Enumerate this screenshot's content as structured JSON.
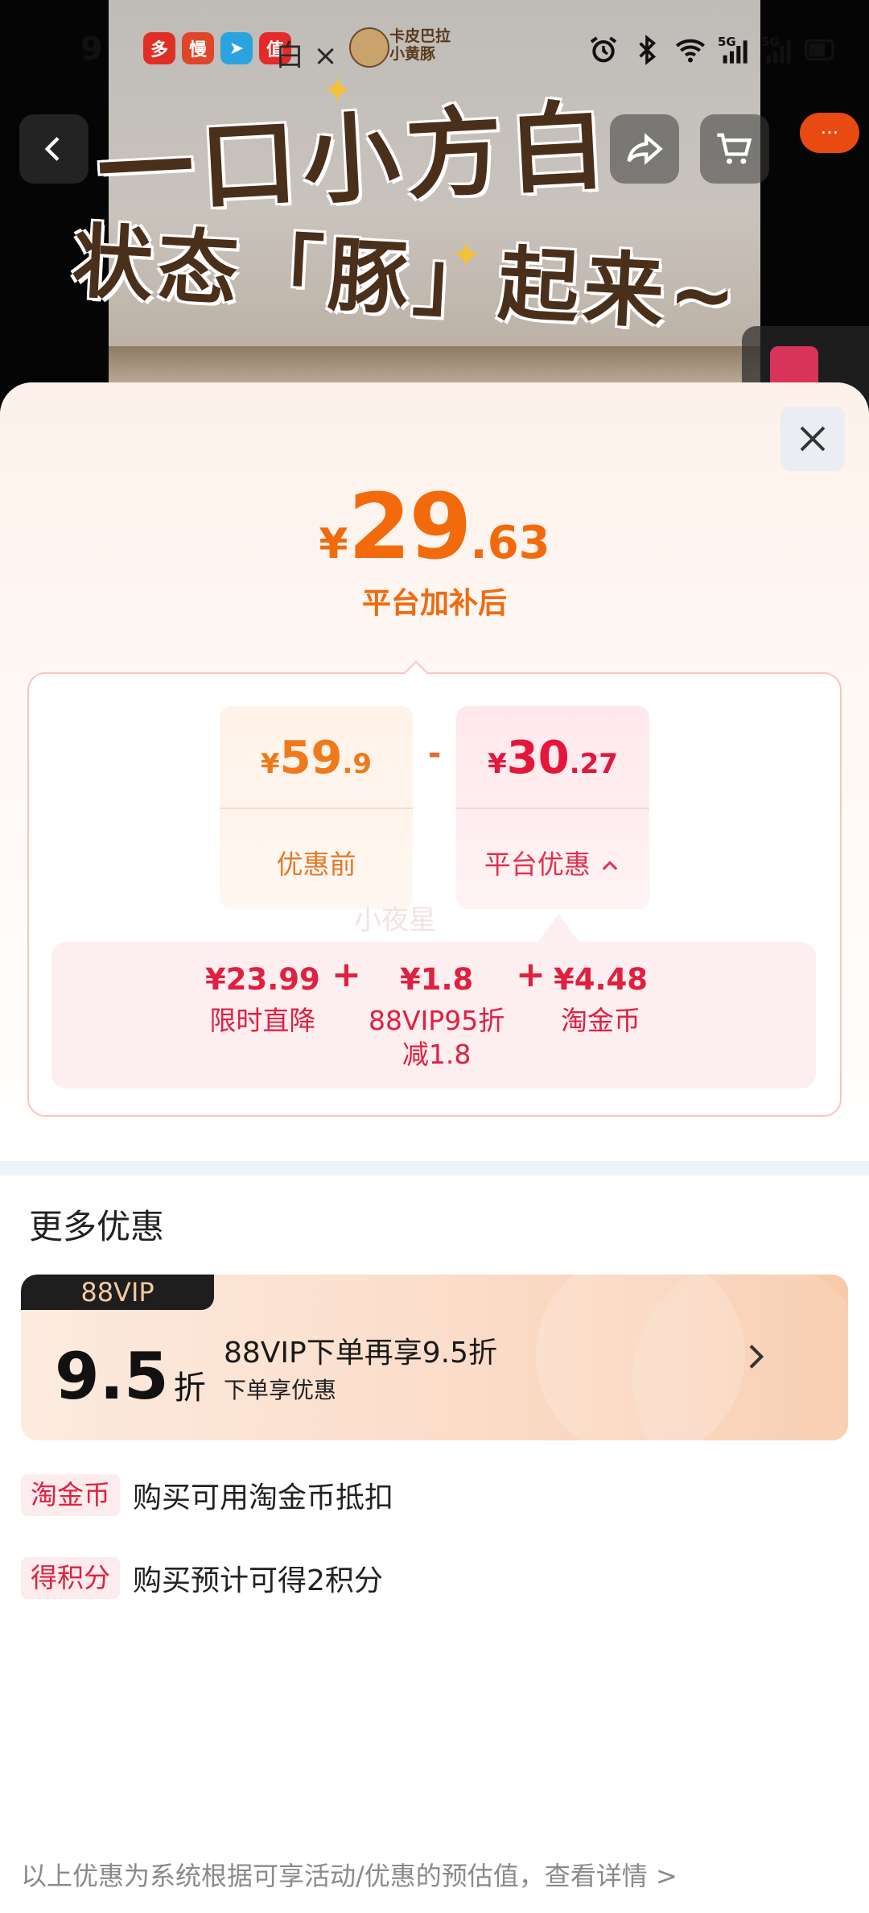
{
  "status_bar": {
    "time": "9",
    "notif_icons": [
      {
        "name": "pinduoduo-icon",
        "glyph": "多",
        "color": "#e02e24"
      },
      {
        "name": "app-icon",
        "glyph": "慢",
        "color": "#e0452a"
      },
      {
        "name": "telegram-icon",
        "glyph": "➤",
        "color": "#2aa3de"
      },
      {
        "name": "zhidemai-icon",
        "glyph": "值",
        "color": "#e32b2b"
      }
    ],
    "text": "白 ×"
  },
  "banner": {
    "line1": "一口小方白",
    "line2": "状态「豚」起来~",
    "brand_logo_line1": "卡皮巴拉",
    "brand_logo_line2": "小黄豚"
  },
  "nav": {
    "more_label": "···"
  },
  "sheet": {
    "final_price": {
      "currency": "¥",
      "integer": "29",
      "decimal": ".63"
    },
    "final_label": "平台加补后",
    "original": {
      "currency": "¥",
      "integer": "59",
      "decimal": ".9",
      "label": "优惠前"
    },
    "minus": "-",
    "discount": {
      "currency": "¥",
      "integer": "30",
      "decimal": ".27",
      "label": "平台优惠"
    },
    "watermark": "小夜星",
    "details": [
      {
        "amount": "¥23.99",
        "label": "限时直降"
      },
      {
        "amount": "¥1.8",
        "label": "88VIP95折",
        "label2": "减1.8"
      },
      {
        "amount": "¥4.48",
        "label": "淘金币"
      }
    ],
    "plus": "+",
    "more_title": "更多优惠",
    "vip": {
      "tag": "88VIP",
      "discount_num": "9.5",
      "discount_unit": "折",
      "title": "88VIP下单再享9.5折",
      "subtitle": "下单享优惠"
    },
    "benefits": [
      {
        "tag": "淘金币",
        "text": "购买可用淘金币抵扣"
      },
      {
        "tag": "得积分",
        "text": "购买预计可得2积分"
      }
    ],
    "footer": "以上优惠为系统根据可享活动/优惠的预估值，查看详情 >"
  },
  "colors": {
    "accent_orange": "#f26a0c",
    "accent_red": "#e0203f"
  }
}
